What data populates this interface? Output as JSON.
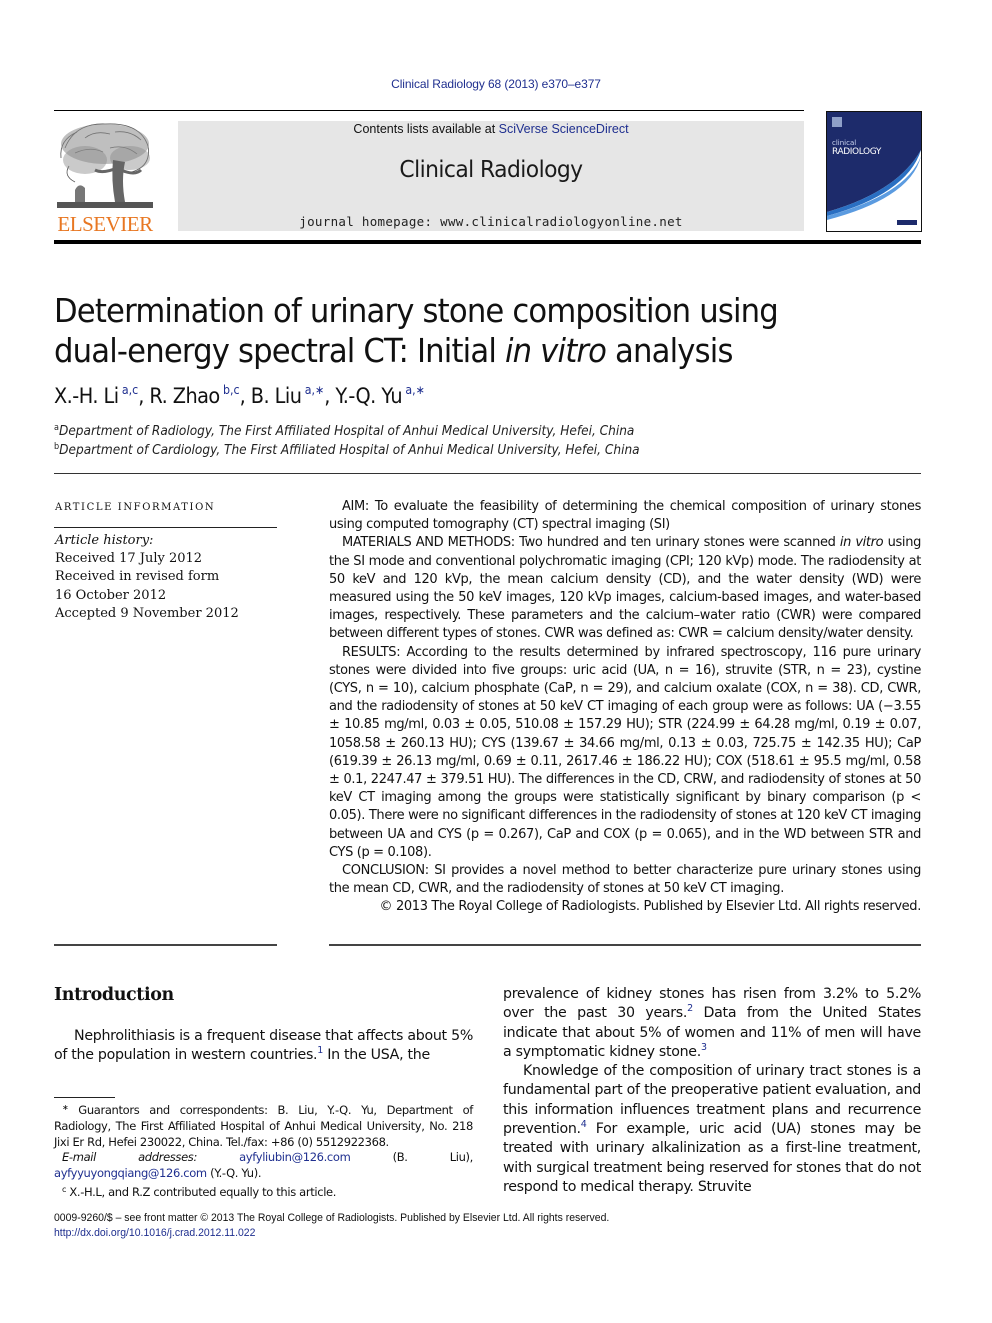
{
  "running_head": "Clinical Radiology 68 (2013) e370–e377",
  "masthead": {
    "publisher_logo_text": "ELSEVIER",
    "contents_prefix": "Contents lists available at ",
    "contents_link": "SciVerse ScienceDirect",
    "journal_name": "Clinical Radiology",
    "homepage": "journal homepage: www.clinicalradiologyonline.net",
    "cover": {
      "line1": "clinical",
      "line2": "RADIOLOGY",
      "bg_color": "#1d2b6b",
      "accent_color": "#2a6fc2"
    },
    "colors": {
      "elsevier_orange": "#e87722",
      "link_blue": "#1f2f8f",
      "masthead_gray": "#e6e6e6"
    }
  },
  "article": {
    "title_line1": "Determination of urinary stone composition using",
    "title_line2_prefix": "dual-energy spectral CT: Initial ",
    "title_line2_italic": "in vitro",
    "title_line2_suffix": " analysis",
    "authors": [
      {
        "name": "X.-H. Li",
        "affils": "a,c",
        "sep": ", "
      },
      {
        "name": "R. Zhao",
        "affils": "b,c",
        "sep": ", "
      },
      {
        "name": "B. Liu",
        "affils": "a,∗",
        "sep": ", "
      },
      {
        "name": "Y.-Q. Yu",
        "affils": "a,∗",
        "sep": ""
      }
    ],
    "affiliations": [
      {
        "mark": "a",
        "text": "Department of Radiology, The First Affiliated Hospital of Anhui Medical University, Hefei, China"
      },
      {
        "mark": "b",
        "text": "Department of Cardiology, The First Affiliated Hospital of Anhui Medical University, Hefei, China"
      }
    ]
  },
  "article_info": {
    "heading": "ARTICLE INFORMATION",
    "history_label": "Article history:",
    "history": [
      "Received 17 July 2012",
      "Received in revised form",
      "16 October 2012",
      "Accepted 9 November 2012"
    ]
  },
  "abstract": {
    "aim": "AIM: To evaluate the feasibility of determining the chemical composition of urinary stones using computed tomography (CT) spectral imaging (SI)",
    "methods_pre": "MATERIALS AND METHODS: Two hundred and ten urinary stones were scanned ",
    "methods_italic": "in vitro",
    "methods_post": " using the SI mode and conventional polychromatic imaging (CPI; 120 kVp) mode. The radiodensity at 50 keV and 120 kVp, the mean calcium density (CD), and the water density (WD) were measured using the 50 keV images, 120 kVp images, calcium-based images, and water-based images, respectively. These parameters and the calcium–water ratio (CWR) were compared between different types of stones. CWR was defined as: CWR = calcium density/water density.",
    "results": "RESULTS: According to the results determined by infrared spectroscopy, 116 pure urinary stones were divided into five groups: uric acid (UA, n = 16), struvite (STR, n = 23), cystine (CYS, n = 10), calcium phosphate (CaP, n = 29), and calcium oxalate (COX, n = 38). CD, CWR, and the radiodensity of stones at 50 keV CT imaging of each group were as follows: UA (−3.55 ± 10.85 mg/ml, 0.03 ± 0.05, 510.08 ± 157.29 HU); STR (224.99 ± 64.28 mg/ml, 0.19 ± 0.07, 1058.58 ± 260.13 HU); CYS (139.67 ± 34.66 mg/ml, 0.13 ± 0.03, 725.75 ± 142.35 HU); CaP (619.39 ± 26.13 mg/ml, 0.69 ± 0.11, 2617.46 ± 186.22 HU); COX (518.61 ± 95.5 mg/ml, 0.58 ± 0.1, 2247.47 ± 379.51 HU). The differences in the CD, CRW, and radiodensity of stones at 50 keV CT imaging among the groups were statistically significant by binary comparison (p < 0.05). There were no significant differences in the radiodensity of stones at 120 keV CT imaging between UA and CYS (p = 0.267), CaP and COX (p = 0.065), and in the WD between STR and CYS (p = 0.108).",
    "conclusion": "CONCLUSION: SI provides a novel method to better characterize pure urinary stones using the mean CD, CWR, and the radiodensity of stones at 50 keV CT imaging.",
    "copyright": "© 2013 The Royal College of Radiologists. Published by Elsevier Ltd. All rights reserved."
  },
  "introduction": {
    "heading": "Introduction",
    "left_p1_a": "Nephrolithiasis is a frequent disease that affects about 5% of the population in western countries.",
    "left_p1_ref1": "1",
    "left_p1_b": " In the USA, the",
    "right_p1_a": "prevalence of kidney stones has risen from 3.2% to 5.2% over the past 30 years.",
    "right_p1_ref2": "2",
    "right_p1_b": " Data from the United States indicate that about 5% of women and 11% of men will have a symptomatic kidney stone.",
    "right_p1_ref3": "3",
    "right_p2_a": "Knowledge of the composition of urinary tract stones is a fundamental part of the preoperative patient evaluation, and this information influences treatment plans and recurrence prevention.",
    "right_p2_ref4": "4",
    "right_p2_b": " For example, uric acid (UA) stones may be treated with urinary alkalinization as a first-line treatment, with surgical treatment being reserved for stones that do not respond to medical therapy. Struvite"
  },
  "footnotes": {
    "corr_mark": "∗",
    "corr_text": " Guarantors and correspondents: B. Liu, Y.-Q. Yu, Department of Radiology, The First Affiliated Hospital of Anhui Medical University, No. 218 Jixi Er Rd, Hefei 230022, China. Tel./fax: +86 (0) 5512922368.",
    "email_label": "E-mail addresses:",
    "email1": "ayfyliubin@126.com",
    "email1_owner": " (B. Liu), ",
    "email2": "ayfyyuyongqiang@126.com",
    "email2_owner": " (Y.-Q. Yu).",
    "contrib_mark": "c",
    "contrib_text": " X.-H.L, and R.Z contributed equally to this article."
  },
  "front_matter": {
    "line1": "0009-9260/$ – see front matter © 2013 The Royal College of Radiologists. Published by Elsevier Ltd. All rights reserved.",
    "doi": "http://dx.doi.org/10.1016/j.crad.2012.11.022"
  }
}
